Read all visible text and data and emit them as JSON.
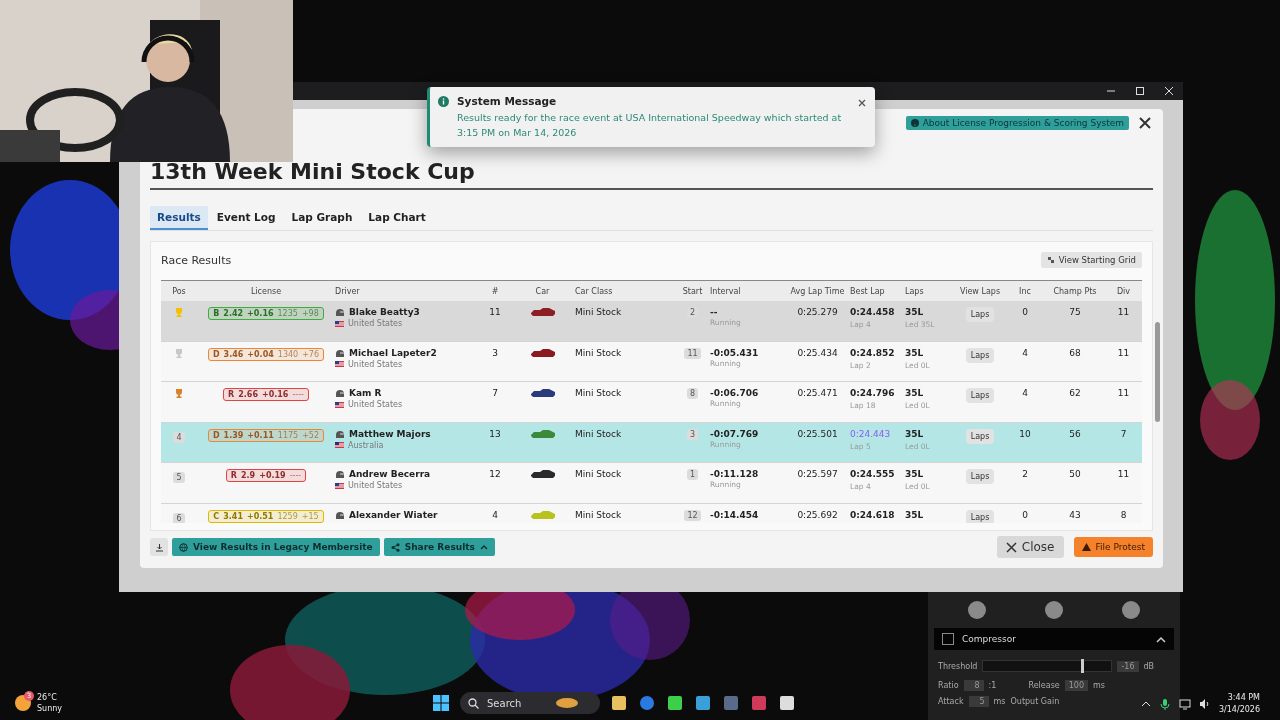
{
  "toast": {
    "title": "System Message",
    "message": "Results ready for the race event at USA International Speedway which started at 3:15 PM on Mar 14, 2026"
  },
  "modal": {
    "help_button": "About License Progression & Scoring System",
    "title": "13th Week Mini Stock Cup",
    "tabs": [
      {
        "label": "Results",
        "selected": true
      },
      {
        "label": "Event Log",
        "selected": false
      },
      {
        "label": "Lap Graph",
        "selected": false
      },
      {
        "label": "Lap Chart",
        "selected": false
      }
    ],
    "card_title": "Race Results",
    "grid_button": "View Starting Grid",
    "columns": [
      "Pos",
      "License",
      "Driver",
      "#",
      "Car",
      "Car Class",
      "Start",
      "Interval",
      "Avg Lap Time",
      "Best Lap",
      "Laps",
      "View Laps",
      "Inc",
      "Champ Pts",
      "Div"
    ],
    "rows": [
      {
        "selected": false,
        "hovered": true,
        "pos": {
          "kind": "trophy",
          "color": "#f2c200"
        },
        "license": {
          "class": "B",
          "sr": "2.42",
          "sr_change": "+0.16",
          "irating": "1235",
          "ir_change": "+98",
          "color": "#3cae3c"
        },
        "driver": "Blake Beatty3",
        "country": "United States",
        "flag": {
          "color": "#2a3f8a"
        },
        "car_no": "11",
        "car": {
          "color": "#8b1f24"
        },
        "car_class": "Mini Stock",
        "start": "2",
        "interval": "--",
        "status": "Running",
        "avg": "0:25.279",
        "best": "0:24.458",
        "best_lap": "Lap 4",
        "fastest": false,
        "laps": "35L",
        "led": "Led 35L",
        "laps_button": "Laps",
        "inc": "0",
        "champ": "75",
        "div": "11"
      },
      {
        "selected": false,
        "hovered": false,
        "pos": {
          "kind": "trophy",
          "color": "#c8c8c8"
        },
        "license": {
          "class": "D",
          "sr": "3.46",
          "sr_change": "+0.04",
          "irating": "1340",
          "ir_change": "+76",
          "color": "#ee8436"
        },
        "driver": "Michael Lapeter2",
        "country": "United States",
        "flag": {
          "color": "#2a3f8a"
        },
        "car_no": "3",
        "car": {
          "color": "#8a1a22"
        },
        "car_class": "Mini Stock",
        "start": "11",
        "interval": "-0:05.431",
        "status": "Running",
        "avg": "0:25.434",
        "best": "0:24.852",
        "best_lap": "Lap 2",
        "fastest": false,
        "laps": "35L",
        "led": "Led 0L",
        "laps_button": "Laps",
        "inc": "4",
        "champ": "68",
        "div": "11"
      },
      {
        "selected": false,
        "hovered": false,
        "pos": {
          "kind": "trophy",
          "color": "#d9822b"
        },
        "license": {
          "class": "R",
          "sr": "2.66",
          "sr_change": "+0.16",
          "irating": "----",
          "color": "#e04444"
        },
        "driver": "Kam R",
        "country": "United States",
        "flag": {
          "color": "#2a3f8a"
        },
        "car_no": "7",
        "car": {
          "color": "#2a3a7a"
        },
        "car_class": "Mini Stock",
        "start": "8",
        "interval": "-0:06.706",
        "status": "Running",
        "avg": "0:25.471",
        "best": "0:24.796",
        "best_lap": "Lap 18",
        "fastest": false,
        "laps": "35L",
        "led": "Led 0L",
        "laps_button": "Laps",
        "inc": "4",
        "champ": "62",
        "div": "11"
      },
      {
        "selected": true,
        "hovered": false,
        "pos": {
          "kind": "number",
          "label": "4"
        },
        "license": {
          "class": "D",
          "sr": "1.39",
          "sr_change": "+0.11",
          "irating": "1175",
          "ir_change": "+52",
          "color": "#ee8436"
        },
        "driver": "Matthew Majors",
        "country": "Australia",
        "flag": {
          "color": "#1f2f8a"
        },
        "car_no": "13",
        "car": {
          "color": "#3a8a3a"
        },
        "car_class": "Mini Stock",
        "start": "3",
        "interval": "-0:07.769",
        "status": "Running",
        "avg": "0:25.501",
        "best": "0:24.443",
        "best_lap": "Lap 5",
        "fastest": true,
        "laps": "35L",
        "led": "Led 0L",
        "laps_button": "Laps",
        "inc": "10",
        "champ": "56",
        "div": "7"
      },
      {
        "selected": false,
        "hovered": false,
        "pos": {
          "kind": "number",
          "label": "5"
        },
        "license": {
          "class": "R",
          "sr": "2.9",
          "sr_change": "+0.19",
          "irating": "----",
          "color": "#e04444"
        },
        "driver": "Andrew Becerra",
        "country": "United States",
        "flag": {
          "color": "#2a3f8a"
        },
        "car_no": "12",
        "car": {
          "color": "#2a2a2e"
        },
        "car_class": "Mini Stock",
        "start": "1",
        "interval": "-0:11.128",
        "status": "Running",
        "avg": "0:25.597",
        "best": "0:24.555",
        "best_lap": "Lap 4",
        "fastest": false,
        "laps": "35L",
        "led": "Led 0L",
        "laps_button": "Laps",
        "inc": "2",
        "champ": "50",
        "div": "11"
      },
      {
        "selected": false,
        "hovered": false,
        "pos": {
          "kind": "number",
          "label": "6"
        },
        "license": {
          "class": "C",
          "sr": "3.41",
          "sr_change": "+0.51",
          "irating": "1259",
          "ir_change": "+15",
          "color": "#e0b800"
        },
        "driver": "Alexander Wiater",
        "car_no": "4",
        "car": {
          "color": "#b8c21e"
        },
        "car_class": "Mini Stock",
        "start": "12",
        "interval": "-0:14.454",
        "avg": "0:25.692",
        "best": "0:24.618",
        "fastest": false,
        "laps": "35L",
        "laps_button": "Laps",
        "inc": "0",
        "champ": "43",
        "div": "8"
      }
    ],
    "footer": {
      "legacy_button": "View Results in Legacy Membersite",
      "share_button": "Share Results",
      "close_button": "Close",
      "protest_button": "File Protest"
    }
  },
  "compressor": {
    "enabled": false,
    "title": "Compressor",
    "threshold": {
      "label": "Threshold",
      "level": 0.76,
      "value": "-16",
      "unit": "dB"
    },
    "ratio": {
      "label": "Ratio",
      "value": "8",
      "unit": ":1"
    },
    "release": {
      "label": "Release",
      "value": "100",
      "unit": "ms"
    },
    "attack": {
      "label": "Attack",
      "value": "5",
      "unit": "ms"
    },
    "output_label": "Output Gain"
  },
  "taskbar": {
    "weather": {
      "temp": "26°C",
      "condition": "Sunny",
      "badge": "3"
    },
    "search": {
      "placeholder": "Search"
    },
    "clock": {
      "time": "3:44 PM",
      "date": "3/14/2026"
    }
  }
}
